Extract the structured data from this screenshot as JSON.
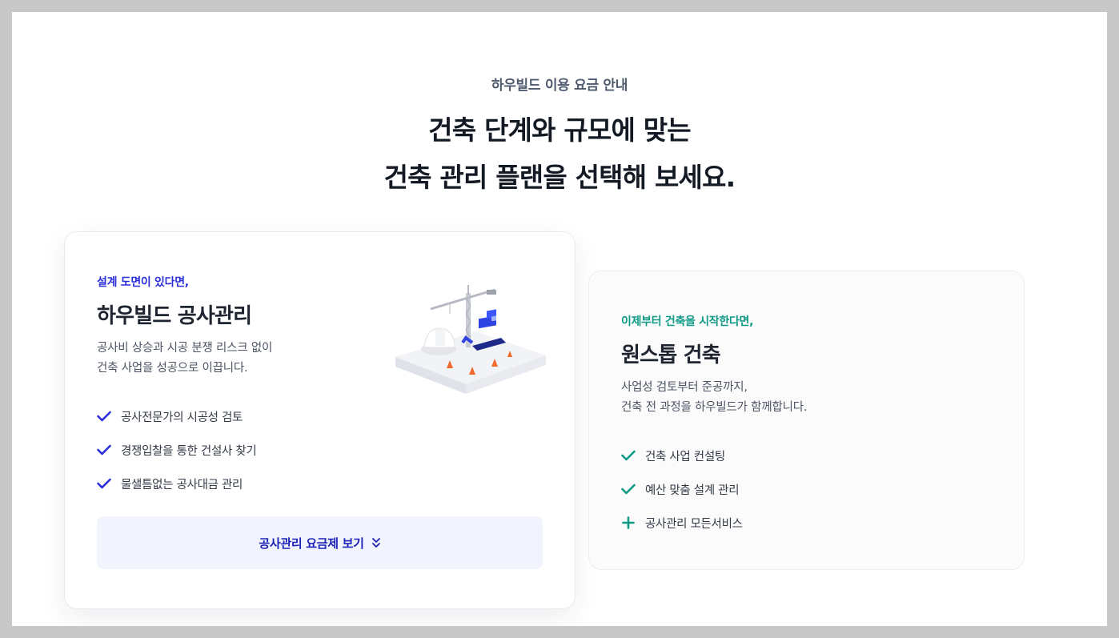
{
  "header": {
    "eyebrow": "하우빌드 이용 요금 안내",
    "headline_line1": "건축 단계와 규모에 맞는",
    "headline_line2": "건축 관리 플랜을 선택해 보세요."
  },
  "plan_construction": {
    "kicker": "설계 도면이 있다면,",
    "title": "하우빌드 공사관리",
    "desc_line1": "공사비 상승과 시공 분쟁 리스크 없이",
    "desc_line2": "건축 사업을 성공으로 이끕니다.",
    "features": [
      {
        "label": "공사전문가의 시공성 검토",
        "icon": "check-icon"
      },
      {
        "label": "경쟁입찰을 통한 건설사 찾기",
        "icon": "check-icon"
      },
      {
        "label": "물샐틈없는 공사대금 관리",
        "icon": "check-icon"
      }
    ],
    "cta_label": "공사관리 요금제 보기",
    "accent": "#2b2fd9"
  },
  "plan_onestop": {
    "kicker": "이제부터 건축을 시작한다면,",
    "title": "원스톱 건축",
    "desc_line1": "사업성 검토부터 준공까지,",
    "desc_line2": "건축 전 과정을 하우빌드가 함께합니다.",
    "features": [
      {
        "label": "건축 사업 컨설팅",
        "icon": "check-icon"
      },
      {
        "label": "예산 맞춤 설계 관리",
        "icon": "check-icon"
      },
      {
        "label": "공사관리 모든서비스",
        "icon": "plus-icon"
      }
    ],
    "accent": "#0e9a85"
  }
}
